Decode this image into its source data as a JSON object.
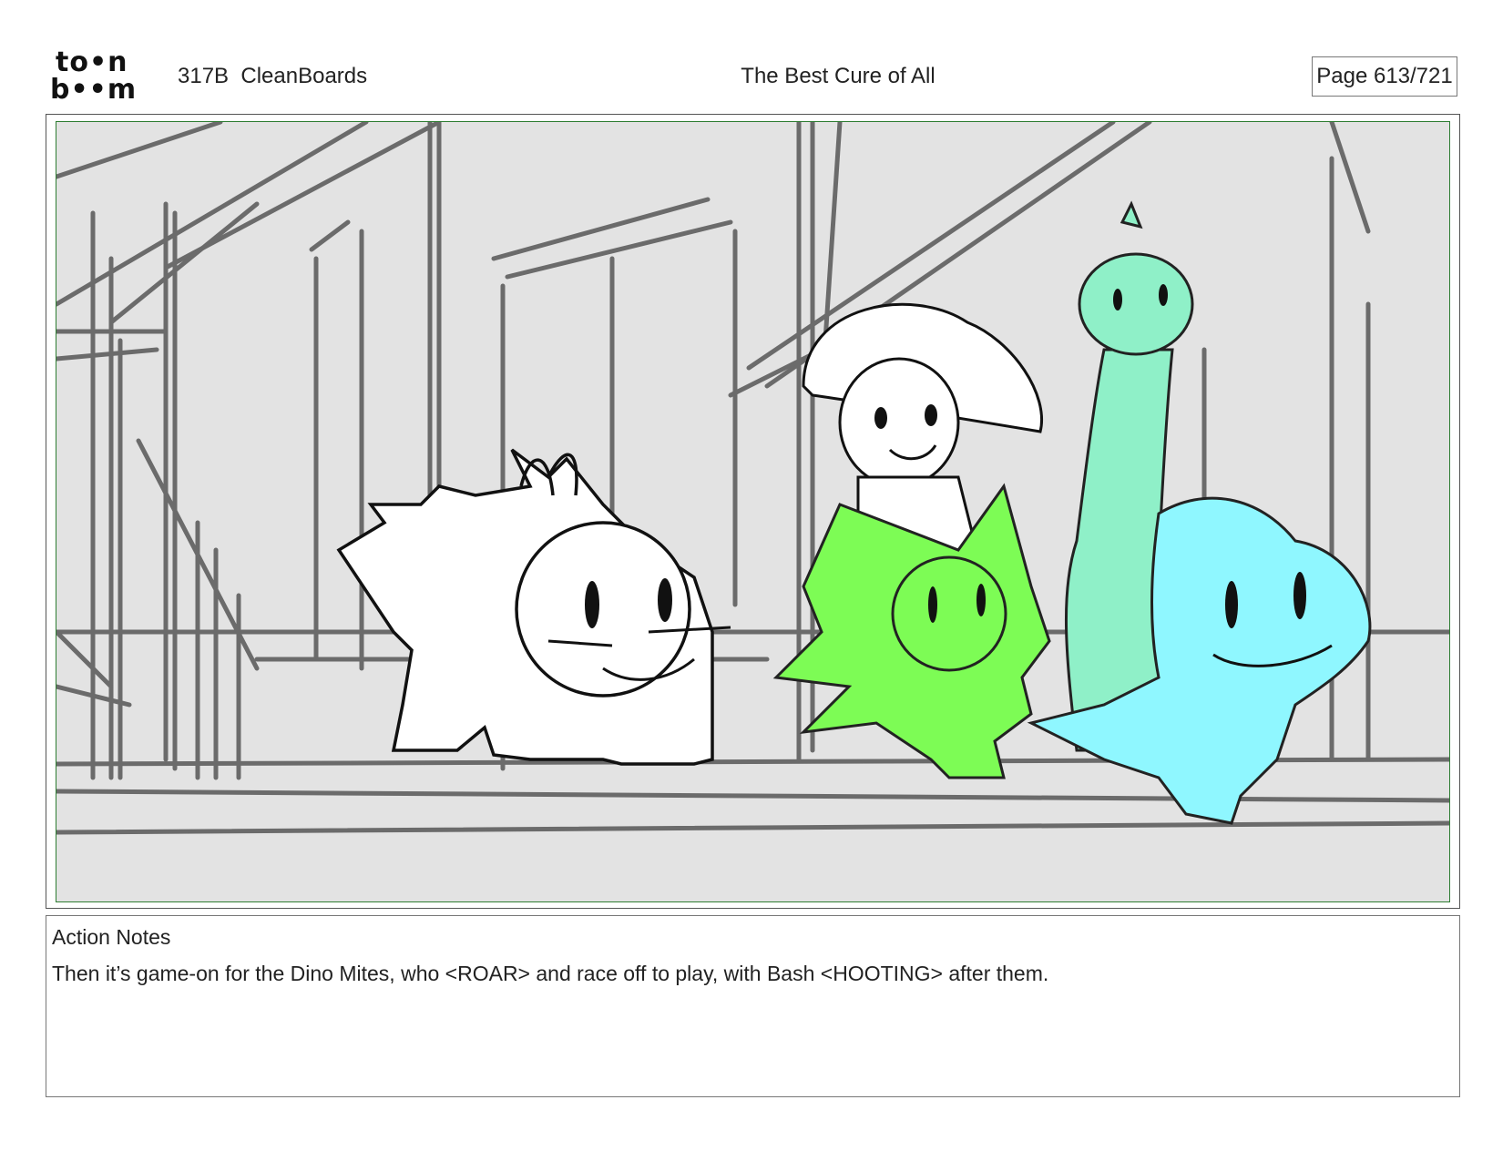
{
  "header": {
    "logo_top": "to•n",
    "logo_bottom": "b••m",
    "episode": "317B  CleanBoards",
    "title": "The Best Cure of All",
    "page": "Page 613/721"
  },
  "notes": {
    "heading": "Action Notes",
    "text": "Then it’s game-on for the Dino Mites, who <ROAR> and race off to play, with Bash <HOOTING> after them."
  },
  "colors": {
    "panel_border": "#2e7d32",
    "dino_green": "#7dfc55",
    "dino_teal": "#8ff0c8",
    "dino_cyan": "#8ff7ff",
    "background_sketch": "#e3e3e3"
  }
}
